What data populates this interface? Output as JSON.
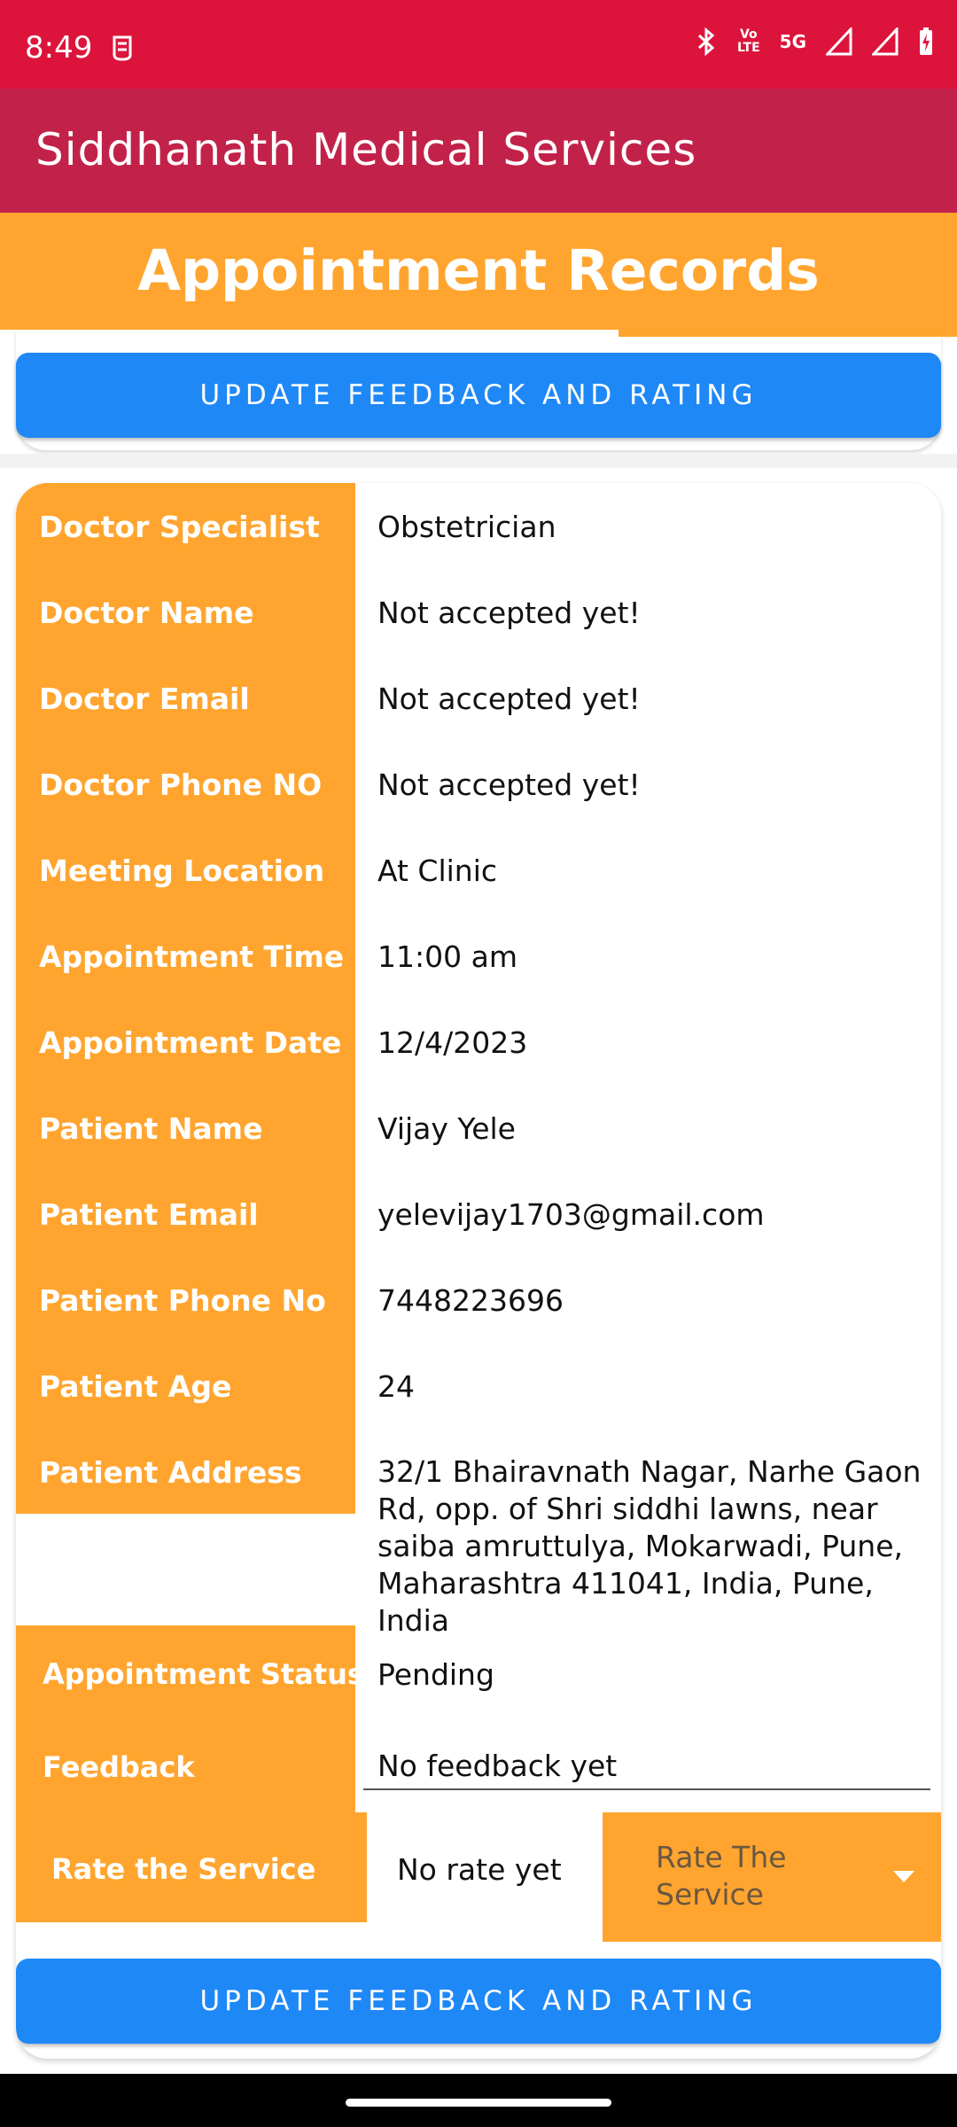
{
  "status_bar": {
    "time": "8:49",
    "icons": [
      "notification-icon",
      "bluetooth-icon",
      "volte-lte-icon",
      "5g-icon",
      "signal-icon",
      "signal-icon-2",
      "battery-charging-icon"
    ],
    "lte_label_top": "Vo",
    "lte_label_bottom": "LTE",
    "g5_label": "5G"
  },
  "app_bar": {
    "title": "Siddhanath Medical Services"
  },
  "header": {
    "title": "Appointment Records"
  },
  "first_card": {
    "update_button_label": "UPDATE FEEDBACK AND RATING"
  },
  "record": {
    "rows": [
      {
        "label": "Doctor Specialist",
        "value": "Obstetrician"
      },
      {
        "label": "Doctor Name",
        "value": "Not accepted yet!"
      },
      {
        "label": "Doctor Email",
        "value": "Not accepted yet!"
      },
      {
        "label": "Doctor Phone NO",
        "value": "Not accepted yet!"
      },
      {
        "label": "Meeting Location",
        "value": "At Clinic"
      },
      {
        "label": "Appointment Time",
        "value": "11:00 am"
      },
      {
        "label": "Appointment Date",
        "value": "12/4/2023"
      },
      {
        "label": "Patient Name",
        "value": "Vijay Yele"
      },
      {
        "label": "Patient Email",
        "value": "yelevijay1703@gmail.com"
      },
      {
        "label": "Patient Phone No",
        "value": "7448223696"
      },
      {
        "label": "Patient Age",
        "value": "24"
      },
      {
        "label": "Patient Address",
        "value": "32/1 Bhairavnath Nagar, Narhe Gaon Rd, opp. of Shri siddhi lawns, near saiba amruttulya, Mokarwadi, Pune, Maharashtra 411041, India, Pune, India"
      },
      {
        "label": "Appointment Status",
        "value": "Pending"
      },
      {
        "label": "Feedback",
        "value": "No feedback yet"
      },
      {
        "label": "Rate the Service",
        "value": "No rate yet"
      }
    ],
    "rate_dropdown": {
      "selected": "Rate The Service"
    },
    "update_button_label": "UPDATE FEEDBACK AND RATING"
  },
  "colors": {
    "status_bar": "#dc143c",
    "app_bar": "#c2224a",
    "accent_orange": "#ffa52f",
    "button_blue": "#1e88f7"
  }
}
